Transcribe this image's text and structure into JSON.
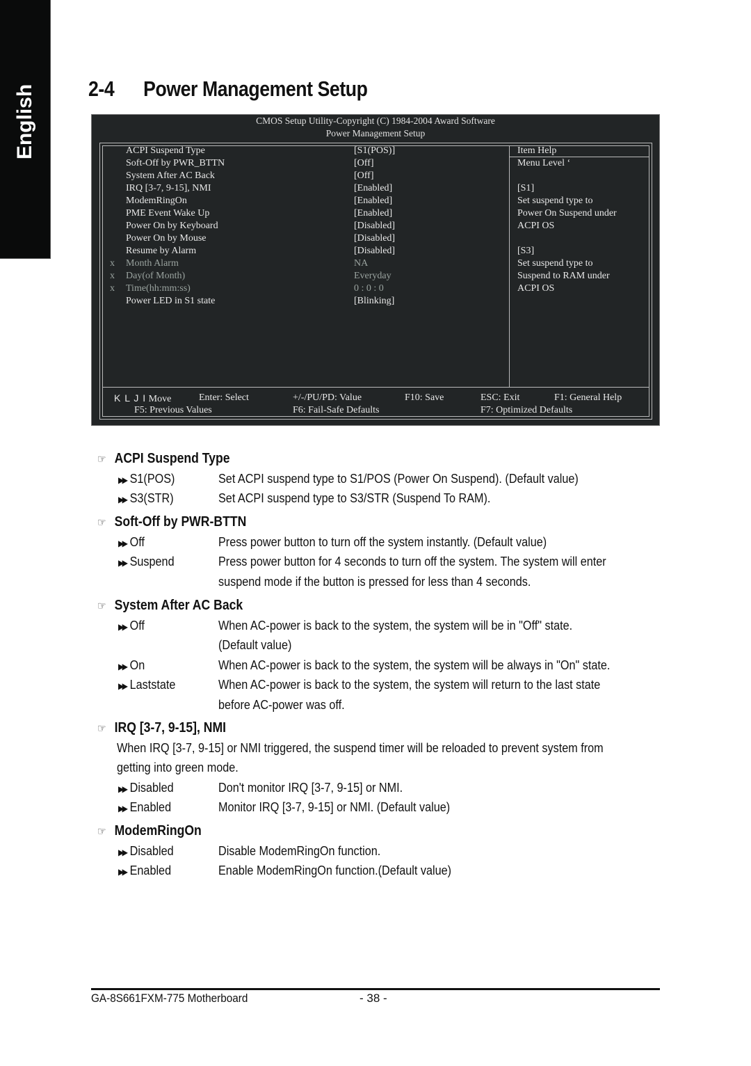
{
  "side_tab": {
    "label": "English"
  },
  "page": {
    "section_number": "2-4",
    "title": "Power Management Setup"
  },
  "bios": {
    "header_line1": "CMOS Setup Utility-Copyright (C) 1984-2004 Award Software",
    "header_line2": "Power Management Setup",
    "items": [
      {
        "marker": "",
        "label": "ACPI Suspend Type",
        "value": "[S1(POS)]",
        "disabled": false
      },
      {
        "marker": "",
        "label": "Soft-Off by PWR_BTTN",
        "value": "[Off]",
        "disabled": false
      },
      {
        "marker": "",
        "label": "System After AC Back",
        "value": "[Off]",
        "disabled": false
      },
      {
        "marker": "",
        "label": "IRQ [3-7, 9-15], NMI",
        "value": "[Enabled]",
        "disabled": false
      },
      {
        "marker": "",
        "label": "ModemRingOn",
        "value": "[Enabled]",
        "disabled": false
      },
      {
        "marker": "",
        "label": "PME Event Wake Up",
        "value": "[Enabled]",
        "disabled": false
      },
      {
        "marker": "",
        "label": "Power On by Keyboard",
        "value": "[Disabled]",
        "disabled": false
      },
      {
        "marker": "",
        "label": "Power On by Mouse",
        "value": "[Disabled]",
        "disabled": false
      },
      {
        "marker": "",
        "label": "Resume by Alarm",
        "value": "[Disabled]",
        "disabled": false
      },
      {
        "marker": "x",
        "label": "Month Alarm",
        "value": "NA",
        "disabled": true
      },
      {
        "marker": "x",
        "label": "Day(of Month)",
        "value": "Everyday",
        "disabled": true
      },
      {
        "marker": "x",
        "label": "Time(hh:mm:ss)",
        "value": "0 : 0 : 0",
        "disabled": true
      },
      {
        "marker": "",
        "label": "Power LED in S1 state",
        "value": "[Blinking]",
        "disabled": false
      }
    ],
    "help": {
      "title": "Item Help",
      "lines": [
        "Menu Level    ‘",
        "",
        "[S1]",
        "Set suspend type to",
        "Power On Suspend under",
        "ACPI OS",
        "",
        "[S3]",
        "Set suspend type to",
        "Suspend to RAM under",
        "ACPI OS"
      ]
    },
    "keys": {
      "arrows": "K L J I",
      "move": "Move",
      "select": "Enter: Select",
      "value": "+/-/PU/PD: Value",
      "save": "F10: Save",
      "exit": "ESC: Exit",
      "help": "F1: General Help",
      "previous": "F5: Previous Values",
      "failsafe": "F6: Fail-Safe Defaults",
      "optimized": "F7: Optimized Defaults"
    }
  },
  "sections": [
    {
      "title": "ACPI Suspend Type",
      "paragraph": [],
      "options": [
        {
          "name": "S1(POS)",
          "desc": [
            "Set ACPI suspend type to S1/POS (Power On Suspend). (Default value)"
          ]
        },
        {
          "name": "S3(STR)",
          "desc": [
            "Set ACPI suspend type to S3/STR (Suspend To RAM)."
          ]
        }
      ]
    },
    {
      "title": "Soft-Off by PWR-BTTN",
      "paragraph": [],
      "options": [
        {
          "name": "Off",
          "desc": [
            "Press power button to turn off the system instantly. (Default value)"
          ]
        },
        {
          "name": "Suspend",
          "desc": [
            "Press power button for 4 seconds to turn off the system. The system will enter",
            "suspend mode if the button is pressed for less than 4 seconds."
          ]
        }
      ]
    },
    {
      "title": "System After AC Back",
      "paragraph": [],
      "options": [
        {
          "name": "Off",
          "desc": [
            "When AC-power is back to the system, the system will be in \"Off\" state.",
            "(Default value)"
          ]
        },
        {
          "name": "On",
          "desc": [
            "When AC-power is back to the system, the system will be always in \"On\" state."
          ]
        },
        {
          "name": "Laststate",
          "desc": [
            "When AC-power is back to the system, the system will return to the last state",
            "before AC-power was off."
          ]
        }
      ]
    },
    {
      "title": "IRQ [3-7, 9-15], NMI",
      "paragraph": [
        "When IRQ [3-7, 9-15] or NMI triggered, the suspend timer will be reloaded to prevent system from",
        "getting into green mode."
      ],
      "options": [
        {
          "name": "Disabled",
          "desc": [
            "Don't monitor IRQ [3-7, 9-15] or NMI."
          ]
        },
        {
          "name": "Enabled",
          "desc": [
            "Monitor IRQ [3-7, 9-15] or NMI. (Default value)"
          ]
        }
      ]
    },
    {
      "title": "ModemRingOn",
      "paragraph": [],
      "options": [
        {
          "name": "Disabled",
          "desc": [
            "Disable ModemRingOn function."
          ]
        },
        {
          "name": "Enabled",
          "desc": [
            "Enable ModemRingOn function.(Default value)"
          ]
        }
      ]
    }
  ],
  "footer": {
    "product": "GA-8S661FXM-775 Motherboard",
    "page_number": "- 38 -"
  }
}
